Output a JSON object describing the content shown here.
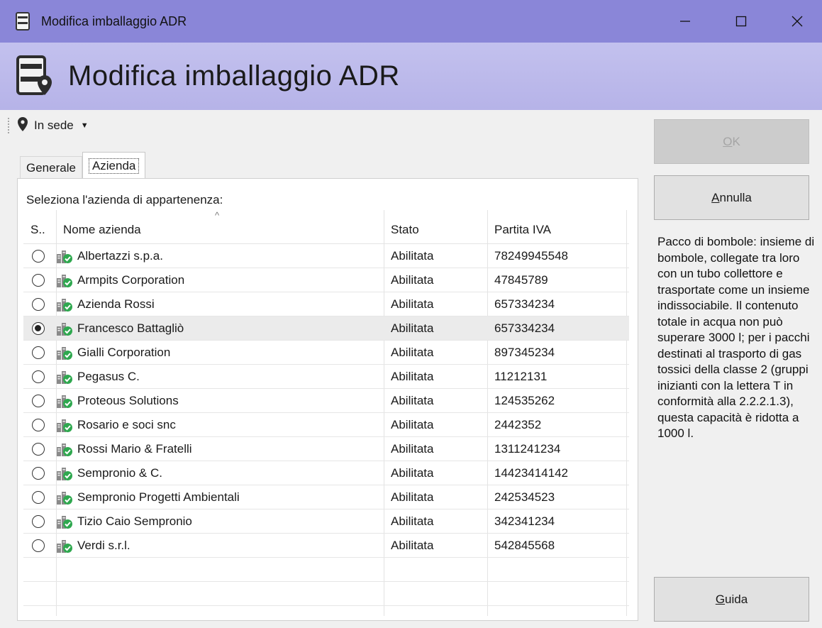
{
  "window": {
    "title": "Modifica imballaggio ADR",
    "minimize_glyph": "—",
    "maximize_glyph": "☐",
    "close_glyph": "✕"
  },
  "banner": {
    "title": "Modifica imballaggio ADR",
    "icon": "adr-package-icon"
  },
  "location": {
    "label": "In sede",
    "icon": "map-pin-icon"
  },
  "tabs": [
    {
      "label": "Generale",
      "active": false
    },
    {
      "label": "Azienda",
      "active": true
    }
  ],
  "panel": {
    "prompt": "Seleziona l'azienda di appartenenza:"
  },
  "grid": {
    "headers": {
      "select": "S..",
      "name": "Nome azienda",
      "status": "Stato",
      "vat": "Partita IVA"
    },
    "sort_arrow": "^",
    "rows": [
      {
        "name": "Albertazzi s.p.a.",
        "status": "Abilitata",
        "vat": "78249945548",
        "selected": false
      },
      {
        "name": "Armpits Corporation",
        "status": "Abilitata",
        "vat": "47845789",
        "selected": false
      },
      {
        "name": "Azienda Rossi",
        "status": "Abilitata",
        "vat": "657334234",
        "selected": false
      },
      {
        "name": "Francesco Battagliò",
        "status": "Abilitata",
        "vat": "657334234",
        "selected": true
      },
      {
        "name": "Gialli Corporation",
        "status": "Abilitata",
        "vat": "897345234",
        "selected": false
      },
      {
        "name": "Pegasus C.",
        "status": "Abilitata",
        "vat": "11212131",
        "selected": false
      },
      {
        "name": "Proteous Solutions",
        "status": "Abilitata",
        "vat": "124535262",
        "selected": false
      },
      {
        "name": "Rosario e soci snc",
        "status": "Abilitata",
        "vat": "2442352",
        "selected": false
      },
      {
        "name": "Rossi Mario & Fratelli",
        "status": "Abilitata",
        "vat": "1311241234",
        "selected": false
      },
      {
        "name": "Sempronio & C.",
        "status": "Abilitata",
        "vat": "14423414142",
        "selected": false
      },
      {
        "name": "Sempronio Progetti Ambientali",
        "status": "Abilitata",
        "vat": "242534523",
        "selected": false
      },
      {
        "name": "Tizio Caio Sempronio",
        "status": "Abilitata",
        "vat": "342341234",
        "selected": false
      },
      {
        "name": "Verdi s.r.l.",
        "status": "Abilitata",
        "vat": "542845568",
        "selected": false
      }
    ]
  },
  "buttons": {
    "ok": {
      "mnemonic": "O",
      "rest": "K"
    },
    "cancel": {
      "mnemonic": "A",
      "rest": "nnulla"
    },
    "help": {
      "mnemonic": "G",
      "rest": "uida"
    }
  },
  "help_text": "Pacco di bombole: insieme di bombole, collegate tra loro con un tubo collettore e trasportate come un insieme indissociabile. Il contenuto totale in acqua non può superare 3000 l; per i pacchi destinati al trasporto di gas tossici della classe 2 (gruppi inizianti con la lettera T in conformità alla 2.2.2.1.3), questa capacità è ridotta a 1000 l.",
  "colors": {
    "titlebar": "#8a86d8",
    "banner": "#b6b3e8",
    "selected_row": "#ebebeb",
    "check_green": "#2fa84f"
  }
}
